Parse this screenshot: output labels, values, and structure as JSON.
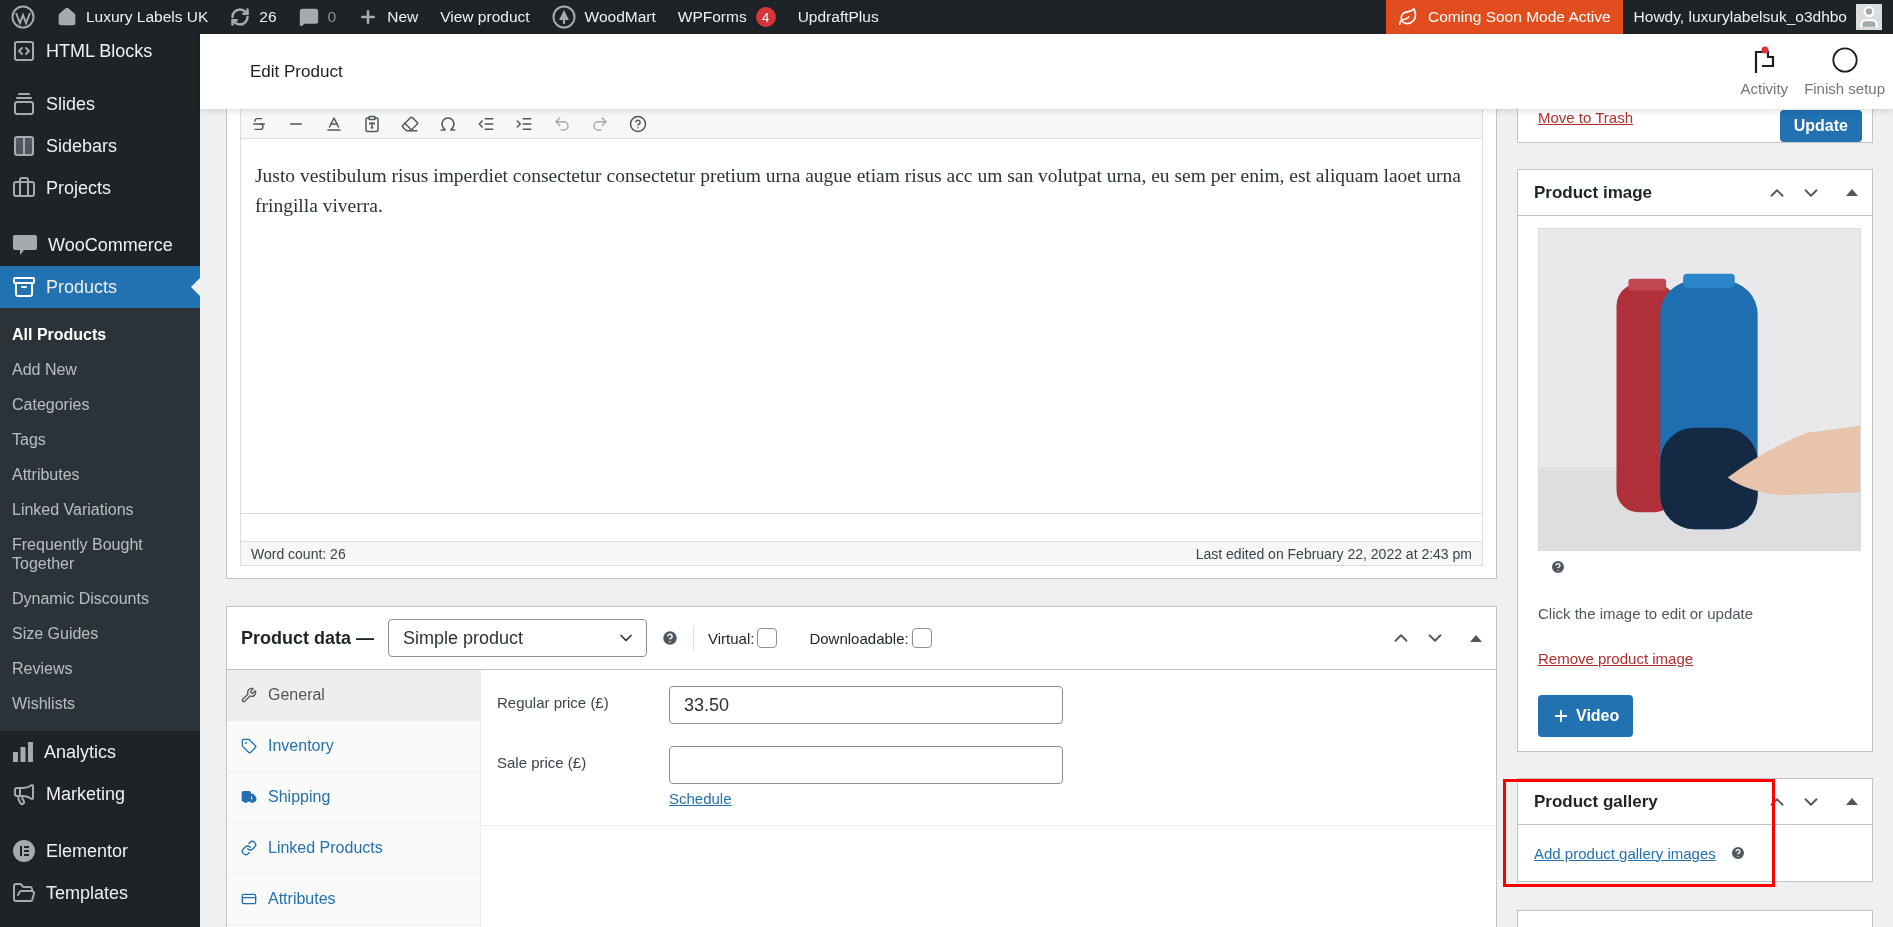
{
  "admin_bar": {
    "items": [
      {
        "kind": "home",
        "label": "Luxury Labels UK"
      },
      {
        "kind": "updates",
        "label": "26"
      },
      {
        "kind": "comments",
        "label": "0"
      },
      {
        "kind": "new",
        "label": "New"
      },
      {
        "kind": "link",
        "label": "View product"
      },
      {
        "kind": "woodmart",
        "label": "WoodMart"
      },
      {
        "kind": "link",
        "label": "WPForms",
        "badge": "4"
      },
      {
        "kind": "link",
        "label": "UpdraftPlus"
      }
    ],
    "notice": "Coming Soon Mode Active",
    "greeting": "Howdy, luxurylabelsuk_o3dhbo"
  },
  "sidebar": {
    "groups": [
      {
        "items": [
          {
            "kind": "code",
            "label": "HTML Blocks",
            "selected": false
          }
        ]
      },
      {
        "items": [
          {
            "kind": "slides",
            "label": "Slides",
            "selected": false
          },
          {
            "kind": "sidebars",
            "label": "Sidebars",
            "selected": false
          },
          {
            "kind": "projects",
            "label": "Projects",
            "selected": false
          }
        ]
      },
      {
        "items": [
          {
            "kind": "woo",
            "label": "WooCommerce",
            "selected": false
          },
          {
            "kind": "products",
            "label": "Products",
            "selected": true,
            "children": [
              {
                "label": "All Products",
                "selected": true
              },
              {
                "label": "Add New",
                "selected": false
              },
              {
                "label": "Categories",
                "selected": false
              },
              {
                "label": "Tags",
                "selected": false
              },
              {
                "label": "Attributes",
                "selected": false
              },
              {
                "label": "Linked Variations",
                "selected": false
              },
              {
                "label": "Frequently Bought Together",
                "selected": false
              },
              {
                "label": "Dynamic Discounts",
                "selected": false
              },
              {
                "label": "Size Guides",
                "selected": false
              },
              {
                "label": "Reviews",
                "selected": false
              },
              {
                "label": "Wishlists",
                "selected": false
              }
            ]
          },
          {
            "kind": "analytics",
            "label": "Analytics",
            "selected": false
          },
          {
            "kind": "marketing",
            "label": "Marketing",
            "selected": false
          }
        ]
      },
      {
        "items": [
          {
            "kind": "elementor",
            "label": "Elementor",
            "selected": false
          },
          {
            "kind": "templates",
            "label": "Templates",
            "selected": false
          }
        ]
      }
    ]
  },
  "header": {
    "title": "Edit Product",
    "actions": [
      {
        "kind": "activity",
        "label": "Activity"
      },
      {
        "kind": "setup",
        "label": "Finish setup"
      }
    ]
  },
  "editor": {
    "content": "Justo vestibulum risus imperdiet consectetur consectetur pretium urna augue etiam risus acc um san volutpat urna, eu sem per enim, est aliquam laoet urna fringilla viverra.",
    "word_count": "Word count: 26",
    "last_edited": "Last edited on February 22, 2022 at 2:43 pm"
  },
  "product_data": {
    "title": "Product data —",
    "type": "Simple product",
    "options": [
      {
        "label": "Virtual:",
        "checked": false
      },
      {
        "label": "Downloadable:",
        "checked": false
      }
    ],
    "tabs": [
      {
        "kind": "general",
        "label": "General",
        "selected": true
      },
      {
        "kind": "inventory",
        "label": "Inventory",
        "selected": false
      },
      {
        "kind": "shipping",
        "label": "Shipping",
        "selected": false
      },
      {
        "kind": "linked",
        "label": "Linked Products",
        "selected": false
      },
      {
        "kind": "attributes",
        "label": "Attributes",
        "selected": false
      }
    ],
    "fields": [
      {
        "label": "Regular price (£)",
        "value": "33.50"
      },
      {
        "label": "Sale price (£)",
        "link": "Schedule"
      }
    ]
  },
  "publish": {
    "trash": "Move to Trash",
    "update": "Update"
  },
  "product_image": {
    "title": "Product image",
    "hint": "Click the image to edit or update",
    "remove": "Remove product image",
    "video": "Video"
  },
  "product_gallery": {
    "title": "Product gallery",
    "link": "Add product gallery images"
  }
}
